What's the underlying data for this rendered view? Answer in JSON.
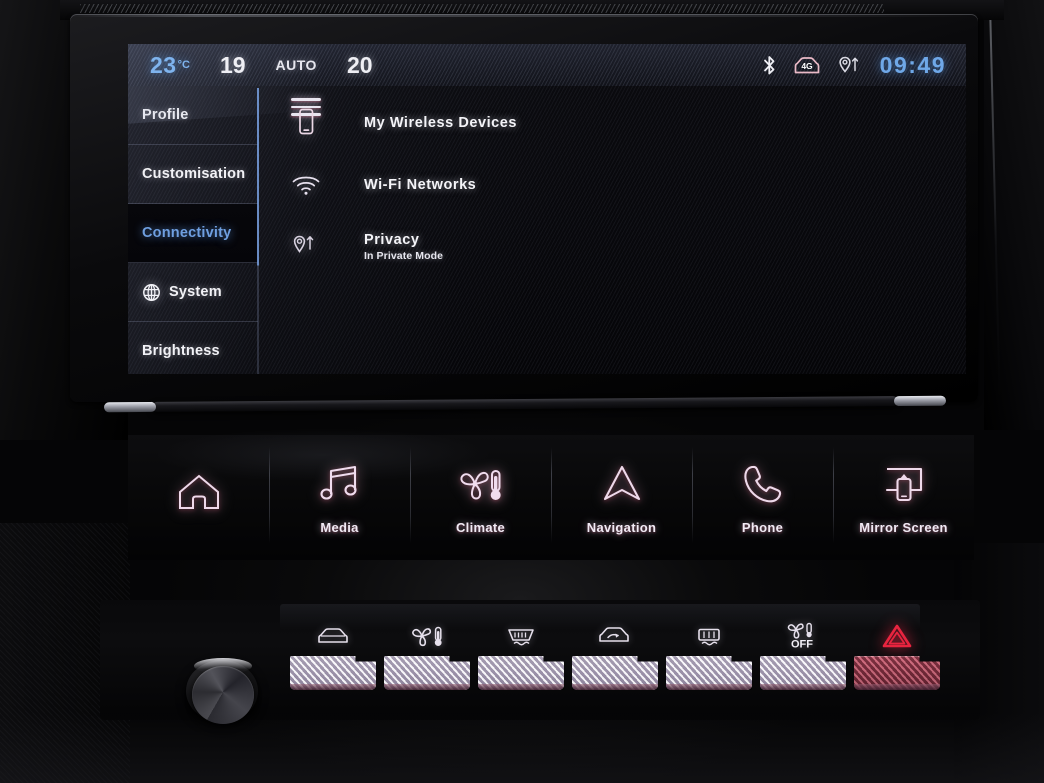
{
  "status_bar": {
    "outside_temp": "23",
    "outside_temp_unit": "°C",
    "left_zone_temp": "19",
    "auto_label": "AUTO",
    "right_zone_temp": "20",
    "clock": "09:49",
    "icons": [
      "bluetooth-icon",
      "4g-car-icon",
      "location-sharing-icon"
    ],
    "network_label": "4G",
    "accent_blue": "#6fa8e8"
  },
  "sidebar": {
    "items": [
      {
        "label": "Profile",
        "icon": "",
        "active": false
      },
      {
        "label": "Customisation",
        "icon": "",
        "active": false
      },
      {
        "label": "Connectivity",
        "icon": "",
        "active": true
      },
      {
        "label": "System",
        "icon": "globe-icon",
        "active": false
      },
      {
        "label": "Brightness",
        "icon": "",
        "active": false
      }
    ],
    "active_color": "#6f9fe0"
  },
  "main": {
    "menu_icon": "hamburger-menu-icon",
    "rows": [
      {
        "title": "My Wireless Devices",
        "subtitle": "",
        "icon": "smartphone-icon"
      },
      {
        "title": "Wi-Fi Networks",
        "subtitle": "",
        "icon": "wifi-icon"
      },
      {
        "title": "Privacy",
        "subtitle": "In Private Mode",
        "icon": "location-privacy-icon"
      }
    ]
  },
  "dock": {
    "items": [
      {
        "label": "",
        "icon": "home-icon"
      },
      {
        "label": "Media",
        "icon": "music-note-icon"
      },
      {
        "label": "Climate",
        "icon": "fan-thermometer-icon"
      },
      {
        "label": "Navigation",
        "icon": "navigation-arrow-icon"
      },
      {
        "label": "Phone",
        "icon": "phone-handset-icon"
      },
      {
        "label": "Mirror Screen",
        "icon": "screen-mirroring-icon"
      }
    ]
  },
  "physical_buttons": {
    "items": [
      {
        "name": "air-conditioning",
        "icon": "car-ac-icon",
        "label": ""
      },
      {
        "name": "fan-temperature",
        "icon": "fan-thermometer-icon",
        "label": ""
      },
      {
        "name": "front-demist",
        "icon": "front-defrost-icon",
        "label": ""
      },
      {
        "name": "air-recirculation",
        "icon": "recirculation-icon",
        "label": ""
      },
      {
        "name": "rear-demist",
        "icon": "rear-defrost-icon",
        "label": ""
      },
      {
        "name": "climate-off",
        "icon": "fan-off-icon",
        "label": "OFF"
      },
      {
        "name": "hazard-lights",
        "icon": "hazard-triangle-icon",
        "label": ""
      }
    ],
    "hazard_color": "#e8243f"
  },
  "controls": {
    "volume_knob": "volume-knob"
  }
}
